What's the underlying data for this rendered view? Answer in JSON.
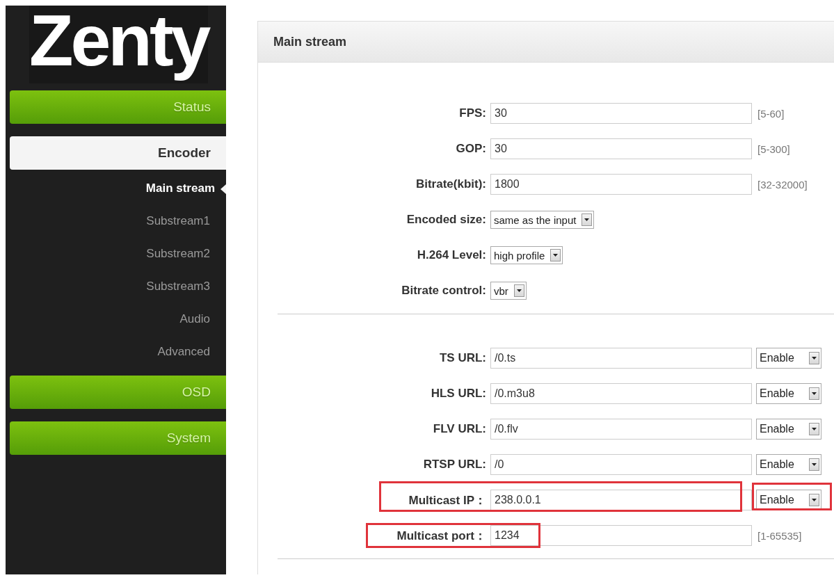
{
  "sidebar": {
    "logo": "Zenty",
    "items": [
      {
        "label": "Status",
        "kind": "section",
        "selected": false
      },
      {
        "label": "Encoder",
        "kind": "section",
        "selected": true
      },
      {
        "label": "Main stream",
        "kind": "sub",
        "selected": true
      },
      {
        "label": "Substream1",
        "kind": "sub",
        "selected": false
      },
      {
        "label": "Substream2",
        "kind": "sub",
        "selected": false
      },
      {
        "label": "Substream3",
        "kind": "sub",
        "selected": false
      },
      {
        "label": "Audio",
        "kind": "sub",
        "selected": false
      },
      {
        "label": "Advanced",
        "kind": "sub",
        "selected": false
      },
      {
        "label": "OSD",
        "kind": "section",
        "selected": false
      },
      {
        "label": "System",
        "kind": "section",
        "selected": false
      }
    ]
  },
  "panel": {
    "title": "Main stream",
    "groups": [
      {
        "fields": [
          {
            "label": "FPS:",
            "kind": "text",
            "value": "30",
            "note": "[5-60]"
          },
          {
            "label": "GOP:",
            "kind": "text",
            "value": "30",
            "note": "[5-300]"
          },
          {
            "label": "Bitrate(kbit):",
            "kind": "text",
            "value": "1800",
            "note": "[32-32000]"
          },
          {
            "label": "Encoded size:",
            "kind": "select",
            "value": "same as the input"
          },
          {
            "label": "H.264 Level:",
            "kind": "select",
            "value": "high profile"
          },
          {
            "label": "Bitrate control:",
            "kind": "select",
            "value": "vbr"
          }
        ]
      },
      {
        "fields": [
          {
            "label": "TS URL:",
            "kind": "text",
            "value": "/0.ts",
            "toggle": {
              "value": "Enable"
            }
          },
          {
            "label": "HLS URL:",
            "kind": "text",
            "value": "/0.m3u8",
            "toggle": {
              "value": "Enable"
            }
          },
          {
            "label": "FLV URL:",
            "kind": "text",
            "value": "/0.flv",
            "toggle": {
              "value": "Enable"
            }
          },
          {
            "label": "RTSP URL:",
            "kind": "text",
            "value": "/0",
            "toggle": {
              "value": "Enable"
            }
          },
          {
            "label": "Multicast IP：",
            "kind": "text",
            "value": "238.0.0.1",
            "toggle": {
              "value": "Enable",
              "highlighted": true
            },
            "highlighted": true
          },
          {
            "label": "Multicast port：",
            "kind": "text",
            "value": "1234",
            "note": "[1-65535]",
            "highlighted": true
          }
        ]
      }
    ]
  }
}
